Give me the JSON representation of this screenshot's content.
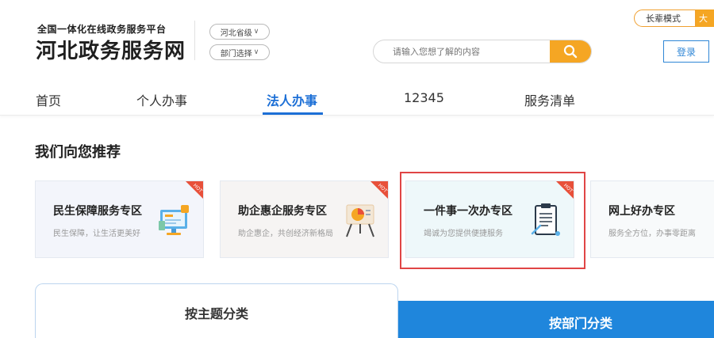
{
  "header": {
    "logo_subtitle": "全国一体化在线政务服务平台",
    "logo_title": "河北政务服务网",
    "region_select": "河北省级",
    "dept_select": "部门选择",
    "search_placeholder": "请输入您想了解的内容",
    "care_mode": "长辈模式",
    "care_mode_2": "大",
    "login": "登录"
  },
  "nav": {
    "items": [
      {
        "label": "首页"
      },
      {
        "label": "个人办事"
      },
      {
        "label": "法人办事"
      },
      {
        "label": "12345"
      },
      {
        "label": "服务清单"
      }
    ],
    "active": "法人办事"
  },
  "recommend": {
    "title": "我们向您推荐",
    "cards": [
      {
        "title": "民生保障服务专区",
        "desc": "民生保障，让生活更美好",
        "icon": "monitor-icon",
        "badge": "HOT"
      },
      {
        "title": "助企惠企服务专区",
        "desc": "助企惠企，共创经济新格局",
        "icon": "chart-board-icon",
        "badge": "HOT"
      },
      {
        "title": "一件事一次办专区",
        "desc": "竭诚为您提供便捷服务",
        "icon": "clipboard-icon",
        "badge": "HOT"
      },
      {
        "title": "网上好办专区",
        "desc": "服务全方位，办事零距离",
        "icon": "",
        "badge": ""
      }
    ]
  },
  "category_tabs": {
    "by_topic": "按主题分类",
    "by_department": "按部门分类"
  },
  "colors": {
    "accent_blue": "#1c6fd6",
    "search_orange": "#f5a623",
    "highlight_red": "#e04545",
    "dept_tab_blue": "#1f86dc"
  }
}
